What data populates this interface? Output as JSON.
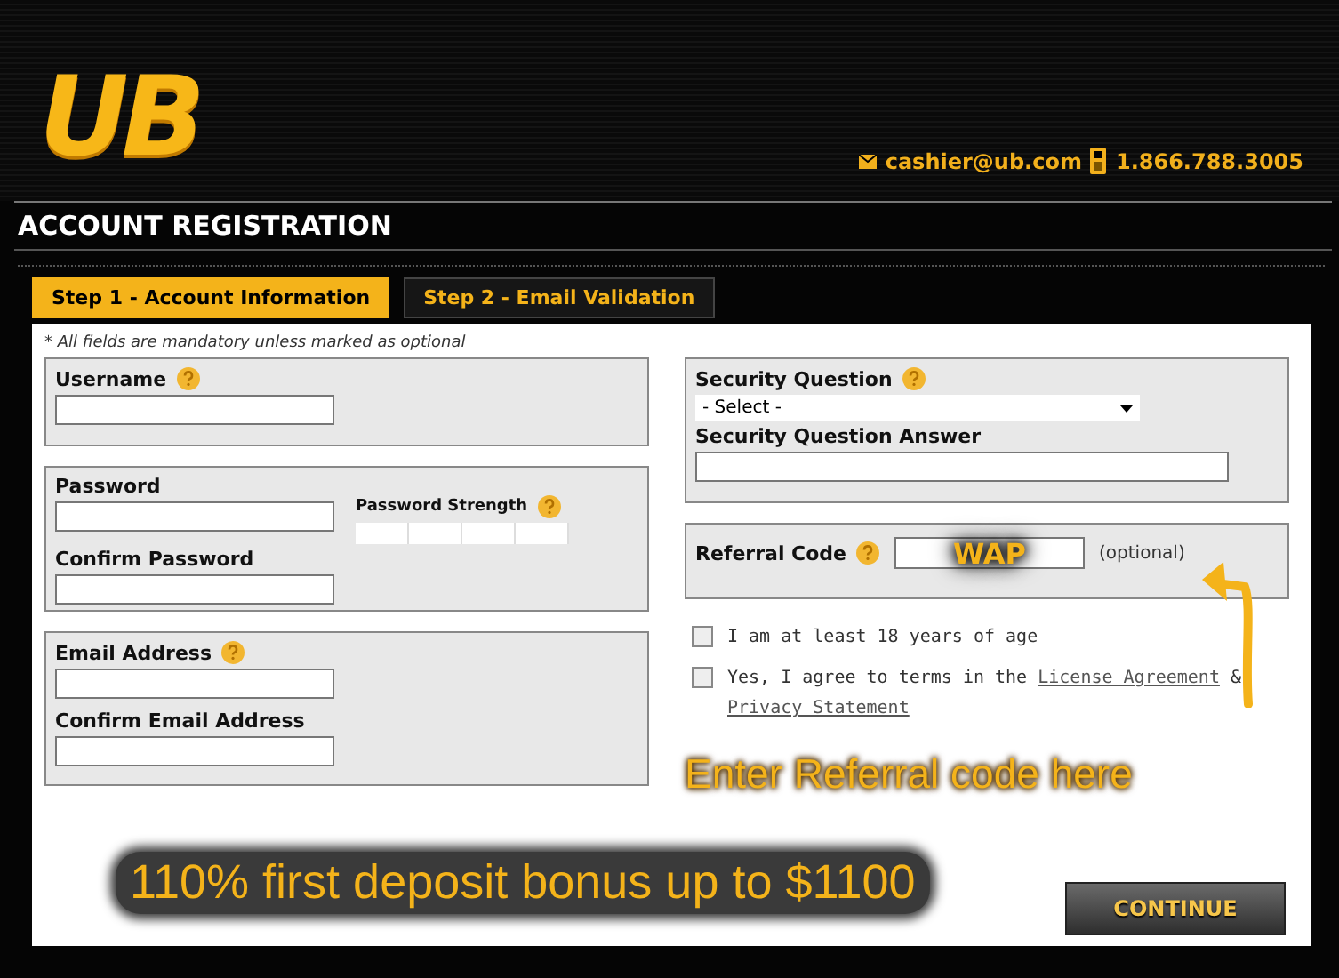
{
  "logo": {
    "text": "UB"
  },
  "contact": {
    "email": "cashier@ub.com",
    "phone": "1.866.788.3005"
  },
  "title": "ACCOUNT REGISTRATION",
  "tabs": [
    {
      "label": "Step 1 - Account Information",
      "selected": true
    },
    {
      "label": "Step 2 - Email Validation",
      "selected": false
    }
  ],
  "note": "* All fields are mandatory unless marked as optional",
  "username": {
    "label": "Username"
  },
  "password": {
    "label": "Password",
    "confirm_label": "Confirm Password",
    "strength_label": "Password Strength"
  },
  "email": {
    "label": "Email Address",
    "confirm_label": "Confirm Email Address"
  },
  "security": {
    "question_label": "Security Question",
    "select_value": "- Select -",
    "answer_label": "Security Question Answer"
  },
  "referral": {
    "label": "Referral Code",
    "value": "WAP",
    "optional": "(optional)"
  },
  "checkboxes": [
    {
      "checked": false,
      "parts": [
        {
          "kind": "text",
          "text": "I am at least 18 years of age"
        }
      ]
    },
    {
      "checked": false,
      "parts": [
        {
          "kind": "text",
          "text": "Yes, I agree to terms in the "
        },
        {
          "kind": "link",
          "text": "License Agreement"
        },
        {
          "kind": "text",
          "text": " & "
        },
        {
          "kind": "link",
          "text": "Privacy Statement"
        }
      ]
    }
  ],
  "annotation": "Enter Referral code here",
  "bonus": "110% first deposit bonus up to $1100",
  "continue": "CONTINUE"
}
